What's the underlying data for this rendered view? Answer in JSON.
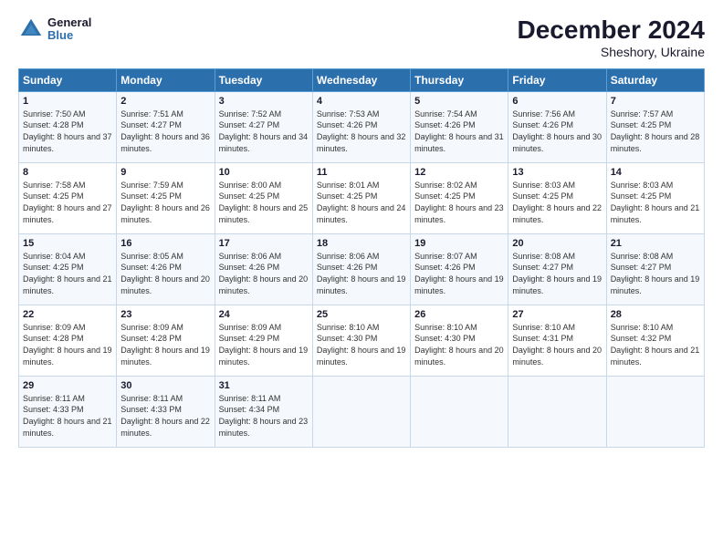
{
  "header": {
    "logo_line1": "General",
    "logo_line2": "Blue",
    "title": "December 2024",
    "subtitle": "Sheshory, Ukraine"
  },
  "columns": [
    "Sunday",
    "Monday",
    "Tuesday",
    "Wednesday",
    "Thursday",
    "Friday",
    "Saturday"
  ],
  "weeks": [
    [
      {
        "day": "1",
        "sunrise": "Sunrise: 7:50 AM",
        "sunset": "Sunset: 4:28 PM",
        "daylight": "Daylight: 8 hours and 37 minutes."
      },
      {
        "day": "2",
        "sunrise": "Sunrise: 7:51 AM",
        "sunset": "Sunset: 4:27 PM",
        "daylight": "Daylight: 8 hours and 36 minutes."
      },
      {
        "day": "3",
        "sunrise": "Sunrise: 7:52 AM",
        "sunset": "Sunset: 4:27 PM",
        "daylight": "Daylight: 8 hours and 34 minutes."
      },
      {
        "day": "4",
        "sunrise": "Sunrise: 7:53 AM",
        "sunset": "Sunset: 4:26 PM",
        "daylight": "Daylight: 8 hours and 32 minutes."
      },
      {
        "day": "5",
        "sunrise": "Sunrise: 7:54 AM",
        "sunset": "Sunset: 4:26 PM",
        "daylight": "Daylight: 8 hours and 31 minutes."
      },
      {
        "day": "6",
        "sunrise": "Sunrise: 7:56 AM",
        "sunset": "Sunset: 4:26 PM",
        "daylight": "Daylight: 8 hours and 30 minutes."
      },
      {
        "day": "7",
        "sunrise": "Sunrise: 7:57 AM",
        "sunset": "Sunset: 4:25 PM",
        "daylight": "Daylight: 8 hours and 28 minutes."
      }
    ],
    [
      {
        "day": "8",
        "sunrise": "Sunrise: 7:58 AM",
        "sunset": "Sunset: 4:25 PM",
        "daylight": "Daylight: 8 hours and 27 minutes."
      },
      {
        "day": "9",
        "sunrise": "Sunrise: 7:59 AM",
        "sunset": "Sunset: 4:25 PM",
        "daylight": "Daylight: 8 hours and 26 minutes."
      },
      {
        "day": "10",
        "sunrise": "Sunrise: 8:00 AM",
        "sunset": "Sunset: 4:25 PM",
        "daylight": "Daylight: 8 hours and 25 minutes."
      },
      {
        "day": "11",
        "sunrise": "Sunrise: 8:01 AM",
        "sunset": "Sunset: 4:25 PM",
        "daylight": "Daylight: 8 hours and 24 minutes."
      },
      {
        "day": "12",
        "sunrise": "Sunrise: 8:02 AM",
        "sunset": "Sunset: 4:25 PM",
        "daylight": "Daylight: 8 hours and 23 minutes."
      },
      {
        "day": "13",
        "sunrise": "Sunrise: 8:03 AM",
        "sunset": "Sunset: 4:25 PM",
        "daylight": "Daylight: 8 hours and 22 minutes."
      },
      {
        "day": "14",
        "sunrise": "Sunrise: 8:03 AM",
        "sunset": "Sunset: 4:25 PM",
        "daylight": "Daylight: 8 hours and 21 minutes."
      }
    ],
    [
      {
        "day": "15",
        "sunrise": "Sunrise: 8:04 AM",
        "sunset": "Sunset: 4:25 PM",
        "daylight": "Daylight: 8 hours and 21 minutes."
      },
      {
        "day": "16",
        "sunrise": "Sunrise: 8:05 AM",
        "sunset": "Sunset: 4:26 PM",
        "daylight": "Daylight: 8 hours and 20 minutes."
      },
      {
        "day": "17",
        "sunrise": "Sunrise: 8:06 AM",
        "sunset": "Sunset: 4:26 PM",
        "daylight": "Daylight: 8 hours and 20 minutes."
      },
      {
        "day": "18",
        "sunrise": "Sunrise: 8:06 AM",
        "sunset": "Sunset: 4:26 PM",
        "daylight": "Daylight: 8 hours and 19 minutes."
      },
      {
        "day": "19",
        "sunrise": "Sunrise: 8:07 AM",
        "sunset": "Sunset: 4:26 PM",
        "daylight": "Daylight: 8 hours and 19 minutes."
      },
      {
        "day": "20",
        "sunrise": "Sunrise: 8:08 AM",
        "sunset": "Sunset: 4:27 PM",
        "daylight": "Daylight: 8 hours and 19 minutes."
      },
      {
        "day": "21",
        "sunrise": "Sunrise: 8:08 AM",
        "sunset": "Sunset: 4:27 PM",
        "daylight": "Daylight: 8 hours and 19 minutes."
      }
    ],
    [
      {
        "day": "22",
        "sunrise": "Sunrise: 8:09 AM",
        "sunset": "Sunset: 4:28 PM",
        "daylight": "Daylight: 8 hours and 19 minutes."
      },
      {
        "day": "23",
        "sunrise": "Sunrise: 8:09 AM",
        "sunset": "Sunset: 4:28 PM",
        "daylight": "Daylight: 8 hours and 19 minutes."
      },
      {
        "day": "24",
        "sunrise": "Sunrise: 8:09 AM",
        "sunset": "Sunset: 4:29 PM",
        "daylight": "Daylight: 8 hours and 19 minutes."
      },
      {
        "day": "25",
        "sunrise": "Sunrise: 8:10 AM",
        "sunset": "Sunset: 4:30 PM",
        "daylight": "Daylight: 8 hours and 19 minutes."
      },
      {
        "day": "26",
        "sunrise": "Sunrise: 8:10 AM",
        "sunset": "Sunset: 4:30 PM",
        "daylight": "Daylight: 8 hours and 20 minutes."
      },
      {
        "day": "27",
        "sunrise": "Sunrise: 8:10 AM",
        "sunset": "Sunset: 4:31 PM",
        "daylight": "Daylight: 8 hours and 20 minutes."
      },
      {
        "day": "28",
        "sunrise": "Sunrise: 8:10 AM",
        "sunset": "Sunset: 4:32 PM",
        "daylight": "Daylight: 8 hours and 21 minutes."
      }
    ],
    [
      {
        "day": "29",
        "sunrise": "Sunrise: 8:11 AM",
        "sunset": "Sunset: 4:33 PM",
        "daylight": "Daylight: 8 hours and 21 minutes."
      },
      {
        "day": "30",
        "sunrise": "Sunrise: 8:11 AM",
        "sunset": "Sunset: 4:33 PM",
        "daylight": "Daylight: 8 hours and 22 minutes."
      },
      {
        "day": "31",
        "sunrise": "Sunrise: 8:11 AM",
        "sunset": "Sunset: 4:34 PM",
        "daylight": "Daylight: 8 hours and 23 minutes."
      },
      null,
      null,
      null,
      null
    ]
  ]
}
